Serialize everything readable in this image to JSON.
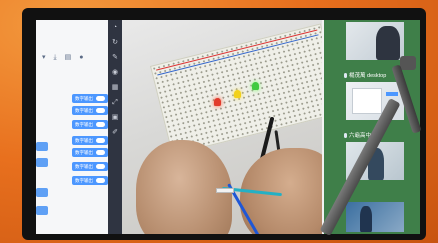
{
  "code_panel": {
    "toolbar_icons": [
      "download-icon",
      "save-icon",
      "user-icon"
    ],
    "toolbar_glyphs": [
      "▾",
      "⤓",
      "▤",
      "●"
    ],
    "blocks": [
      {
        "label": "数字输出"
      },
      {
        "label": "数字输出"
      },
      {
        "label": "数字输出"
      },
      {
        "label": "数字输出"
      },
      {
        "label": "数字输出"
      },
      {
        "label": "数字输出"
      },
      {
        "label": "数字输出"
      }
    ]
  },
  "tool_strip": {
    "icons": [
      "zoom-icon",
      "refresh-icon",
      "pen-icon",
      "eye-icon",
      "grid-icon",
      "fullscreen-icon",
      "layers-icon",
      "brush-icon"
    ],
    "glyphs": [
      "◔",
      "↻",
      "✎",
      "◉",
      "▦",
      "⤢",
      "▣",
      "✐"
    ]
  },
  "participants": [
    {
      "name": ""
    },
    {
      "name": "楊茂萬 desktop"
    },
    {
      "name": "六龜高中"
    },
    {
      "name": ""
    }
  ],
  "colors": {
    "background": "#e8701e",
    "block": "#4c97ff",
    "participants_panel": "#3f7f49"
  }
}
